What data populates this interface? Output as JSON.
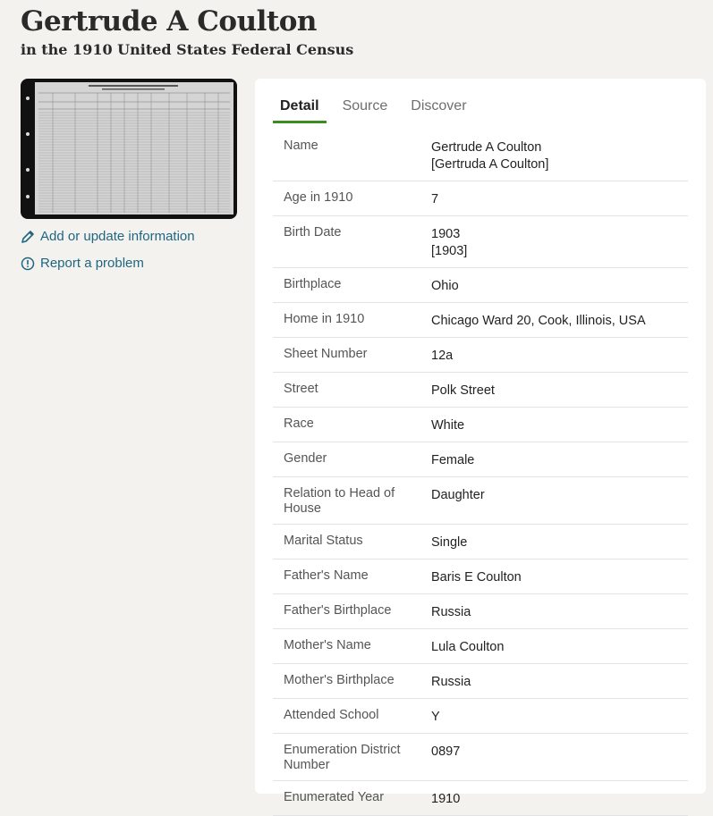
{
  "header": {
    "title": "Gertrude A Coulton",
    "subtitle": "in the 1910 United States Federal Census"
  },
  "sidebar": {
    "thumbnail_icon": "census-record-image",
    "add_info_label": "Add or update information",
    "report_label": "Report a problem"
  },
  "tabs": [
    {
      "label": "Detail",
      "active": true
    },
    {
      "label": "Source",
      "active": false
    },
    {
      "label": "Discover",
      "active": false
    }
  ],
  "details": [
    {
      "label": "Name",
      "values": [
        "Gertrude A Coulton",
        "[Gertruda A Coulton]"
      ]
    },
    {
      "label": "Age in 1910",
      "values": [
        "7"
      ]
    },
    {
      "label": "Birth Date",
      "values": [
        "1903",
        "[1903]"
      ]
    },
    {
      "label": "Birthplace",
      "values": [
        "Ohio"
      ]
    },
    {
      "label": "Home in 1910",
      "values": [
        "Chicago Ward 20, Cook, Illinois, USA"
      ]
    },
    {
      "label": "Sheet Number",
      "values": [
        "12a"
      ]
    },
    {
      "label": "Street",
      "values": [
        "Polk Street"
      ]
    },
    {
      "label": "Race",
      "values": [
        "White"
      ]
    },
    {
      "label": "Gender",
      "values": [
        "Female"
      ]
    },
    {
      "label": "Relation to Head of House",
      "values": [
        "Daughter"
      ]
    },
    {
      "label": "Marital Status",
      "values": [
        "Single"
      ]
    },
    {
      "label": "Father's Name",
      "values": [
        "Baris E Coulton"
      ]
    },
    {
      "label": "Father's Birthplace",
      "values": [
        "Russia"
      ]
    },
    {
      "label": "Mother's Name",
      "values": [
        "Lula Coulton"
      ]
    },
    {
      "label": "Mother's Birthplace",
      "values": [
        "Russia"
      ]
    },
    {
      "label": "Attended School",
      "values": [
        "Y"
      ]
    },
    {
      "label": "Enumeration District Number",
      "values": [
        "0897"
      ]
    },
    {
      "label": "Enumerated Year",
      "values": [
        "1910"
      ]
    }
  ],
  "colors": {
    "accent_tab": "#3b8d20",
    "link": "#1f6681",
    "background": "#f4f2ef"
  }
}
